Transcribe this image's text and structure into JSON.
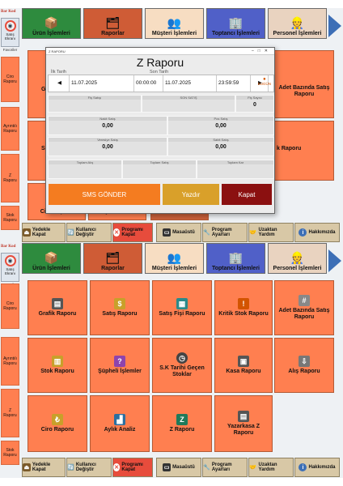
{
  "app": {
    "logo_text": "Bar Kod",
    "side_top_label": "Satış Ekranı",
    "side_favoriler": "Favoriler",
    "side_items": [
      "Ciro Raporu",
      "Ayrıntılı Raporu",
      "Z Raporu",
      "Stok Raporu"
    ],
    "tabs": [
      "Ürün İşlemleri",
      "Raporlar",
      "Müşteri İşlemleri",
      "Toptancı İşlemleri",
      "Personel İşlemleri"
    ],
    "tab_colors": [
      "#2e8b3e",
      "#cf5c36",
      "#f7ddc2",
      "#5060c8",
      "#e9d3c0"
    ],
    "grid_items": [
      "Grafik Raporu",
      "Satış Raporu",
      "Satış Fişi Raporu",
      "Kritik Stok Raporu",
      "Adet Bazında Satış Raporu",
      "Stok Raporu",
      "Şüpheli İşlemler",
      "S.K Tarihi Geçen Stoklar",
      "Kasa Raporu",
      "Alış Raporu",
      "Ciro Raporu",
      "Aylık Analiz",
      "Z Raporu",
      "Yazarkasa Z Raporu"
    ],
    "bottom_bar": [
      "Yedekle Kapat",
      "Kullanıcı Değiştir",
      "Programı Kapat",
      "Masaüstü",
      "Program Ayarları",
      "Uzaktan Yardım",
      "Hakkımızda"
    ]
  },
  "top_visible_grid": {
    "adet_line1": "Adet Bazında Satış",
    "adet_line2": "Raporu",
    "sa_raporu": "Sa",
    "g_prefix": "G",
    "s_prefix": "S",
    "k_prefix": "k Raporu",
    "ciro": "Ciro Raporu",
    "aylik": "Aylık Analiz"
  },
  "modal": {
    "window_title": "Z RAPORU",
    "title": "Z Raporu",
    "start_label": "İlk Tarih",
    "end_label": "Son Tarih",
    "start_date": "11.07.2025",
    "start_time": "00:00:00",
    "end_date": "11.07.2025",
    "end_time": "23:59:59",
    "today": "BUGÜN",
    "stats": [
      {
        "label": "Fiş Satışı",
        "value": ""
      },
      {
        "label": "SON SATIŞ",
        "value": ""
      },
      {
        "label": "Fiş Sayısı",
        "value": "0"
      },
      {
        "label": "Nakit Satış",
        "value": "0,00"
      },
      {
        "label": "Pos Satış",
        "value": "0,00"
      },
      {
        "label": "Veresiye Satış",
        "value": "0,00"
      },
      {
        "label": "Sabit Satış",
        "value": "0,00"
      },
      {
        "label": "Toplam Alış",
        "value": ""
      },
      {
        "label": "Toplam Satış",
        "value": ""
      },
      {
        "label": "Toplam Kar",
        "value": ""
      }
    ],
    "sms_button": "SMS GÖNDER",
    "print_button": "Yazdır",
    "close_button": "Kapat",
    "sms_color": "#f47c20",
    "print_color": "#d9a02a",
    "close_color": "#8b1010"
  }
}
